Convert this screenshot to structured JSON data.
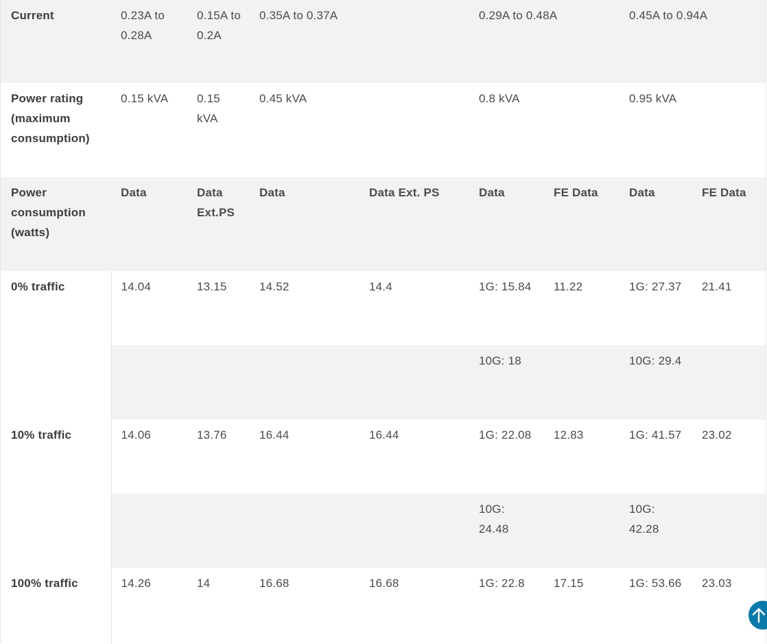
{
  "table": {
    "rows": {
      "current": {
        "label": "Current",
        "cells": [
          "0.23A to 0.28A",
          "0.15A to 0.2A",
          "0.35A to 0.37A",
          "0.29A to 0.48A",
          "0.45A to 0.94A"
        ]
      },
      "power_rating": {
        "label": "Power rating (maximum consumption)",
        "cells": [
          "0.15 kVA",
          "0.15 kVA",
          "0.45 kVA",
          "0.8 kVA",
          "0.95 kVA"
        ]
      },
      "consumption_header": {
        "label": "Power consumption (watts)",
        "cells": [
          "Data",
          "Data Ext.PS",
          "Data",
          "Data Ext. PS",
          "Data",
          "FE Data",
          "Data",
          "FE Data"
        ]
      },
      "traffic_0": {
        "label": "0% traffic",
        "row1": [
          "14.04",
          "13.15",
          "14.52",
          "14.4",
          "1G: 15.84",
          "11.22",
          "1G: 27.37",
          "21.41"
        ],
        "row2": [
          "",
          "",
          "",
          "",
          "10G: 18",
          "",
          "10G: 29.4",
          ""
        ]
      },
      "traffic_10": {
        "label": "10% traffic",
        "row1": [
          "14.06",
          "13.76",
          "16.44",
          "16.44",
          "1G: 22.08",
          "12.83",
          "1G: 41.57",
          "23.02"
        ],
        "row2": [
          "",
          "",
          "",
          "",
          "10G: 24.48",
          "",
          "10G: 42.28",
          ""
        ]
      },
      "traffic_100": {
        "label": "100% traffic",
        "row1": [
          "14.26",
          "14",
          "16.68",
          "16.68",
          "1G: 22.8",
          "17.15",
          "1G: 53.66",
          "23.03"
        ]
      }
    }
  },
  "scroll_top": {
    "icon": "arrow-up-icon",
    "color": "#0a7aa8"
  }
}
